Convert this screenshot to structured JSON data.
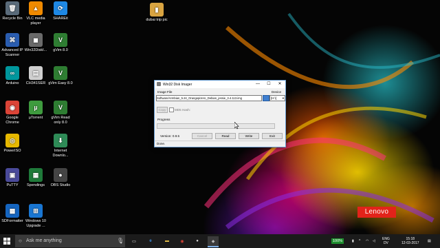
{
  "desktop": {
    "icons": [
      {
        "label": "Recycle Bin",
        "glyph": "🗑",
        "color": "#5a6b7a"
      },
      {
        "label": "VLC media player",
        "glyph": "▲",
        "color": "#f08a00"
      },
      {
        "label": "SHAREit",
        "glyph": "⟳",
        "color": "#1e88e5"
      },
      {
        "label": "dubai trip pic",
        "glyph": "▮",
        "color": "#d9a441"
      },
      {
        "label": "Advanced IP Scanner",
        "glyph": "⌘",
        "color": "#2a5db0"
      },
      {
        "label": "Win32DiskI...",
        "glyph": "◼",
        "color": "#6a6a6a"
      },
      {
        "label": "gVim 8.0",
        "glyph": "V",
        "color": "#2e7d32"
      },
      {
        "label": "Arduino",
        "glyph": "∞",
        "color": "#00979d"
      },
      {
        "label": "CH341SER",
        "glyph": "▤",
        "color": "#cfcfcf"
      },
      {
        "label": "gVim Easy 8.0",
        "glyph": "V",
        "color": "#2e7d32"
      },
      {
        "label": "Google Chrome",
        "glyph": "◉",
        "color": "#db4437"
      },
      {
        "label": "µTorrent",
        "glyph": "µ",
        "color": "#3e9b3e"
      },
      {
        "label": "gVim Read only 8.0",
        "glyph": "V",
        "color": "#2e7d32"
      },
      {
        "label": "PowerISO",
        "glyph": "◎",
        "color": "#e6b800"
      },
      {
        "label": "Internet Downlo...",
        "glyph": "⬇",
        "color": "#2e8b57"
      },
      {
        "label": "PuTTY",
        "glyph": "▣",
        "color": "#4a4a9a"
      },
      {
        "label": "Spendings",
        "glyph": "▦",
        "color": "#1f7a3a"
      },
      {
        "label": "OBS Studio",
        "glyph": "●",
        "color": "#444"
      },
      {
        "label": "SDFormatter",
        "glyph": "▩",
        "color": "#1565c0"
      },
      {
        "label": "Windows 10 Upgrade ...",
        "glyph": "⊞",
        "color": "#1976d2"
      }
    ],
    "brand": "Lenovo"
  },
  "dialog": {
    "title": "Win32 Disk Imager",
    "minimize": "—",
    "maximize": "☐",
    "close": "✕",
    "image_file_label": "Image File",
    "device_label": "Device",
    "path_value": "Software/Armbian_5.24_Orangepizero_Debian_jessie_3.4.113.img",
    "device_value": "[H:\\]",
    "copy_label": "Copy",
    "md5_label": "MD5 Hash:",
    "progress_label": "Progress",
    "version": "Version: 0.9.5",
    "cancel_label": "Cancel",
    "read_label": "Read",
    "write_label": "Write",
    "exit_label": "Exit",
    "status": "Done.",
    "progress": 0
  },
  "taskbar": {
    "search_placeholder": "Ask me anything",
    "battery": "100%",
    "language": "ENG",
    "keyboard": "DV",
    "time": "15:18",
    "date": "12-03-2017"
  }
}
